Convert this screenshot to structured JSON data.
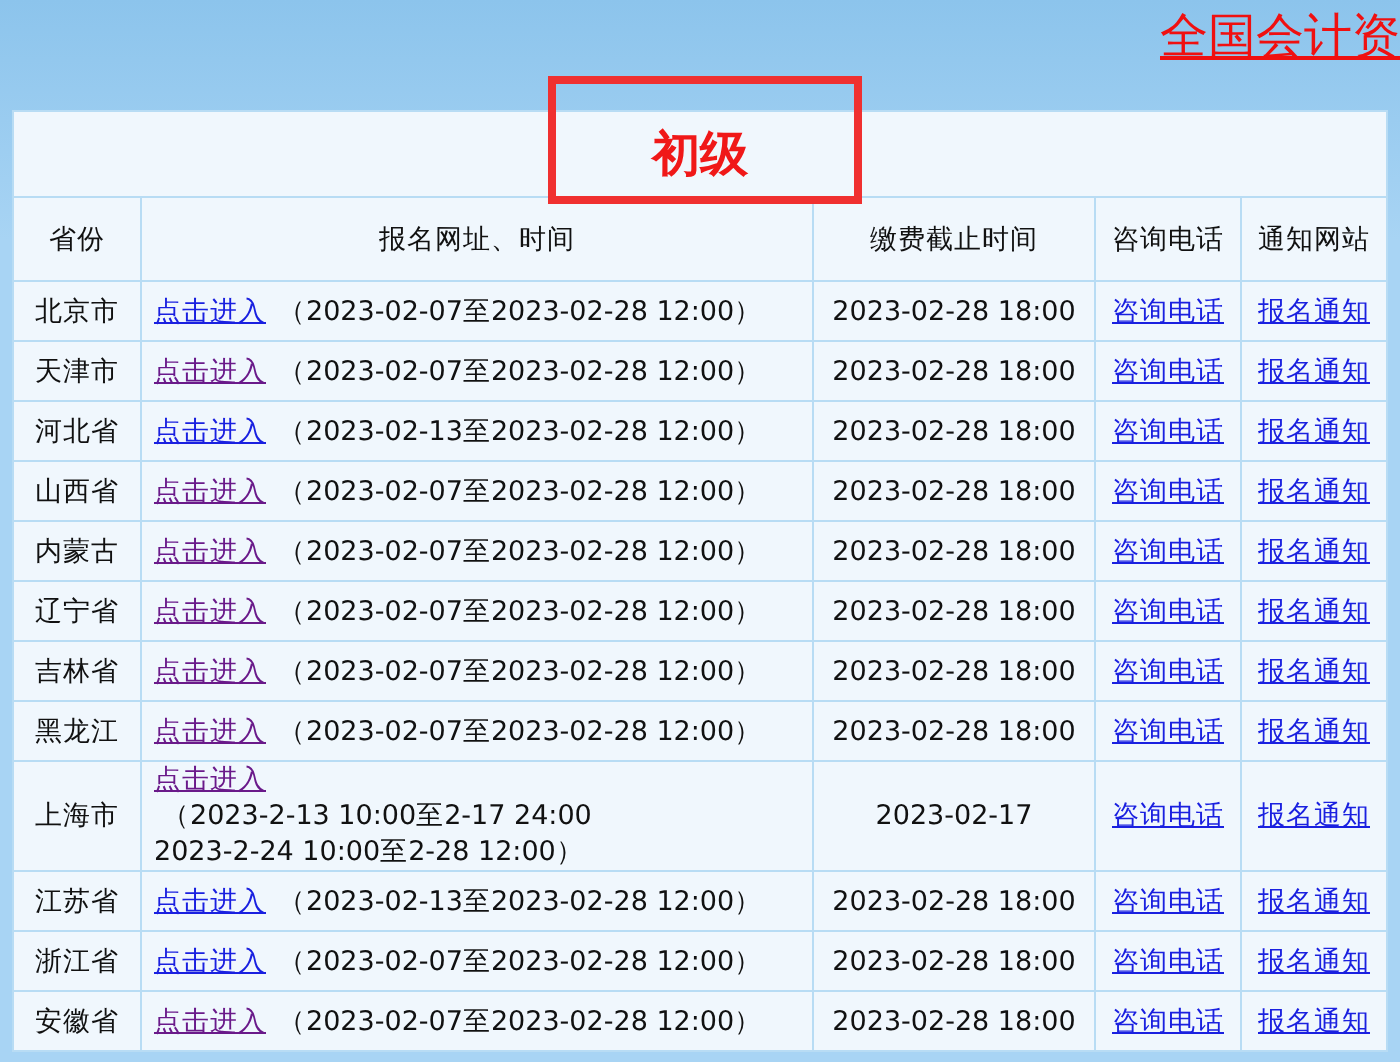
{
  "top_link": "全国会计资",
  "table": {
    "title": "初级",
    "columns": [
      "省份",
      "报名网址、时间",
      "缴费截止时间",
      "咨询电话",
      "通知网站"
    ],
    "rows": [
      {
        "province": "北京市",
        "link": {
          "label": "点击进入",
          "visited": false
        },
        "period": [
          "（2023-02-07至2023-02-28 12:00）"
        ],
        "deadline": "2023-02-28 18:00",
        "phone": "咨询电话",
        "notice": "报名通知"
      },
      {
        "province": "天津市",
        "link": {
          "label": "点击进入",
          "visited": true
        },
        "period": [
          "（2023-02-07至2023-02-28 12:00）"
        ],
        "deadline": "2023-02-28 18:00",
        "phone": "咨询电话",
        "notice": "报名通知"
      },
      {
        "province": "河北省",
        "link": {
          "label": "点击进入",
          "visited": false
        },
        "period": [
          "（2023-02-13至2023-02-28 12:00）"
        ],
        "deadline": "2023-02-28 18:00",
        "phone": "咨询电话",
        "notice": "报名通知"
      },
      {
        "province": "山西省",
        "link": {
          "label": "点击进入",
          "visited": true
        },
        "period": [
          "（2023-02-07至2023-02-28 12:00）"
        ],
        "deadline": "2023-02-28 18:00",
        "phone": "咨询电话",
        "notice": "报名通知"
      },
      {
        "province": "内蒙古",
        "link": {
          "label": "点击进入",
          "visited": true
        },
        "period": [
          "（2023-02-07至2023-02-28 12:00）"
        ],
        "deadline": "2023-02-28 18:00",
        "phone": "咨询电话",
        "notice": "报名通知"
      },
      {
        "province": "辽宁省",
        "link": {
          "label": "点击进入",
          "visited": true
        },
        "period": [
          "（2023-02-07至2023-02-28 12:00）"
        ],
        "deadline": "2023-02-28 18:00",
        "phone": "咨询电话",
        "notice": "报名通知"
      },
      {
        "province": "吉林省",
        "link": {
          "label": "点击进入",
          "visited": true
        },
        "period": [
          "（2023-02-07至2023-02-28 12:00）"
        ],
        "deadline": "2023-02-28 18:00",
        "phone": "咨询电话",
        "notice": "报名通知"
      },
      {
        "province": "黑龙江",
        "link": {
          "label": "点击进入",
          "visited": true
        },
        "period": [
          "（2023-02-07至2023-02-28 12:00）"
        ],
        "deadline": "2023-02-28 18:00",
        "phone": "咨询电话",
        "notice": "报名通知"
      },
      {
        "province": "上海市",
        "link": {
          "label": "点击进入",
          "visited": true
        },
        "period": [
          "（2023-2-13 10:00至2-17 24:00",
          "2023-2-24 10:00至2-28 12:00）"
        ],
        "deadline": "2023-02-17",
        "phone": "咨询电话",
        "notice": "报名通知"
      },
      {
        "province": "江苏省",
        "link": {
          "label": "点击进入",
          "visited": false
        },
        "period": [
          "（2023-02-13至2023-02-28 12:00）"
        ],
        "deadline": "2023-02-28 18:00",
        "phone": "咨询电话",
        "notice": "报名通知"
      },
      {
        "province": "浙江省",
        "link": {
          "label": "点击进入",
          "visited": false
        },
        "period": [
          "（2023-02-07至2023-02-28 12:00）"
        ],
        "deadline": "2023-02-28 18:00",
        "phone": "咨询电话",
        "notice": "报名通知"
      },
      {
        "province": "安徽省",
        "link": {
          "label": "点击进入",
          "visited": true
        },
        "period": [
          "（2023-02-07至2023-02-28 12:00）"
        ],
        "deadline": "2023-02-28 18:00",
        "phone": "咨询电话",
        "notice": "报名通知"
      }
    ]
  }
}
